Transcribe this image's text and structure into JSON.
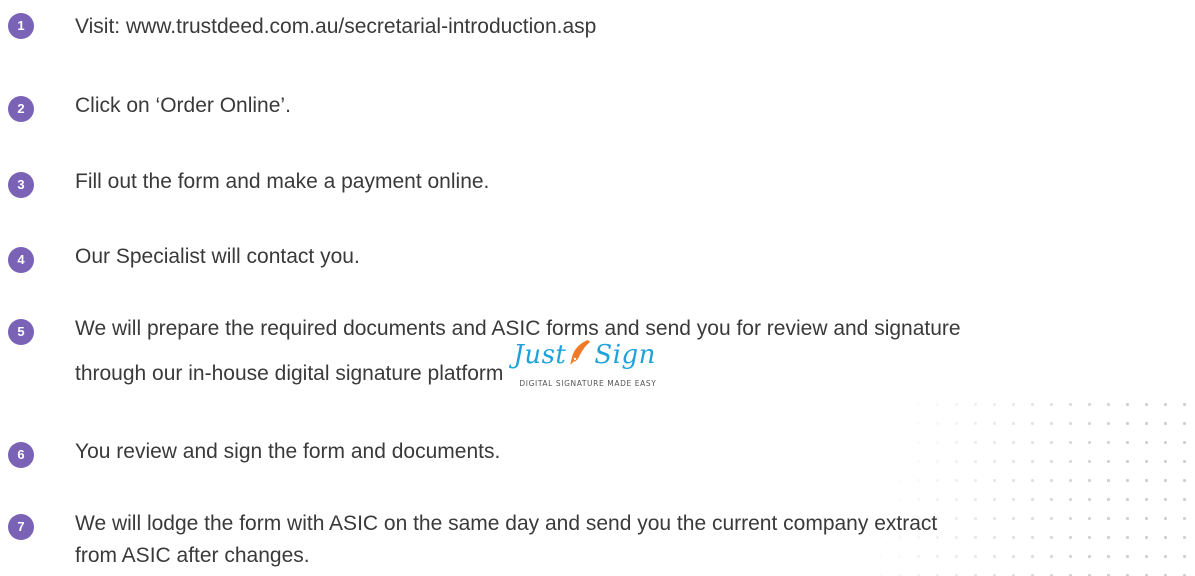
{
  "colors": {
    "accent": "#7a62b6",
    "text": "#3a3a3a",
    "logo_blue": "#1fa3d8",
    "logo_orange": "#f07a27"
  },
  "steps": [
    {
      "number": "1",
      "text": "Visit: www.trustdeed.com.au/secretarial-introduction.asp"
    },
    {
      "number": "2",
      "text": "Click on ‘Order Online’."
    },
    {
      "number": "3",
      "text": "Fill out the form and make a payment online."
    },
    {
      "number": "4",
      "text": "Our Specialist will contact you."
    },
    {
      "number": "5",
      "line1": "We will prepare the required documents and ASIC forms and send you for review and signature",
      "line2": "through our in-house digital signature platform"
    },
    {
      "number": "6",
      "text": "You review and sign the form and documents."
    },
    {
      "number": "7",
      "line1": "We will lodge the form with ASIC on the same day and send you the current company extract",
      "line2": "from ASIC after changes."
    }
  ],
  "logo": {
    "word1": "Just",
    "word2": "Sign",
    "tagline": "DIGITAL SIGNATURE MADE EASY",
    "icon": "pen-nib-icon"
  }
}
